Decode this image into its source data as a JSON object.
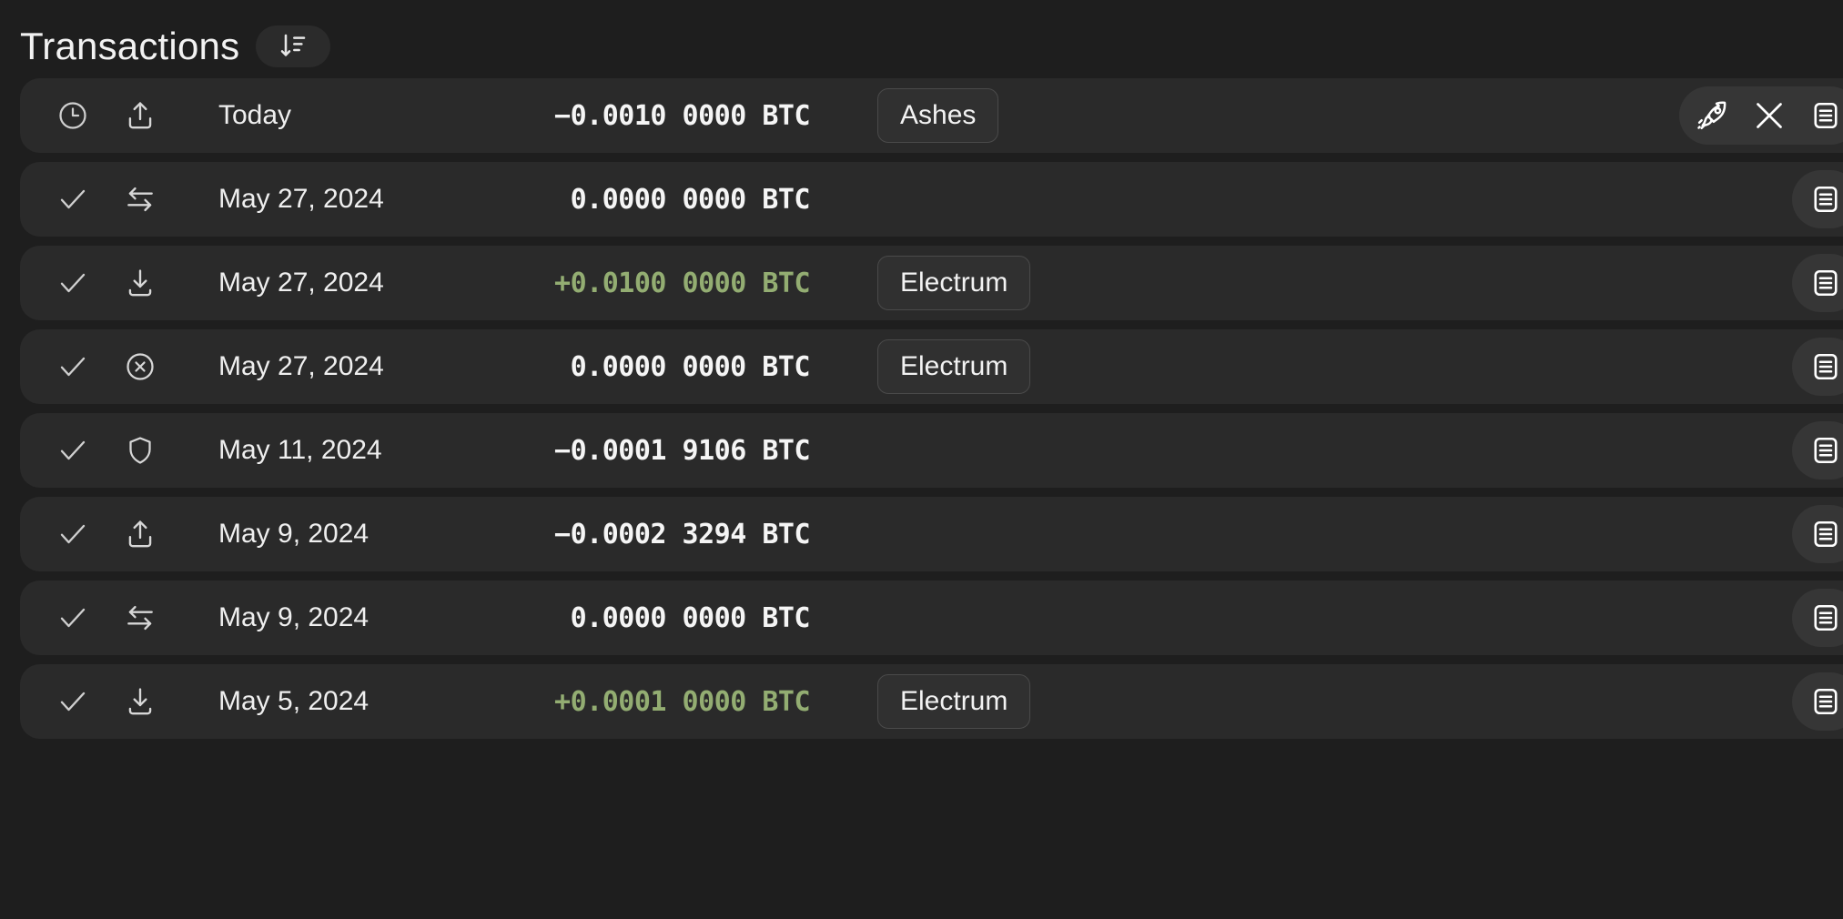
{
  "header": {
    "title": "Transactions",
    "sort_button": {
      "name": "sort-descending",
      "tooltip": "Sort"
    }
  },
  "transactions": [
    {
      "status": "pending",
      "status_icon": "clock-icon",
      "type": "send",
      "type_icon": "upload-icon",
      "date": "Today",
      "amount": "−0.0010 0000 BTC",
      "direction": "negative",
      "label": "Ashes",
      "actions": [
        "rocket-icon",
        "close-icon",
        "details-icon"
      ]
    },
    {
      "status": "confirmed",
      "status_icon": "check-icon",
      "type": "self-transfer",
      "type_icon": "swap-icon",
      "date": "May 27, 2024",
      "amount": "0.0000 0000 BTC",
      "direction": "neutral",
      "label": "",
      "actions": [
        "details-icon"
      ]
    },
    {
      "status": "confirmed",
      "status_icon": "check-icon",
      "type": "receive",
      "type_icon": "download-icon",
      "date": "May 27, 2024",
      "amount": "+0.0100 0000 BTC",
      "direction": "positive",
      "label": "Electrum",
      "actions": [
        "details-icon"
      ]
    },
    {
      "status": "confirmed",
      "status_icon": "check-icon",
      "type": "cancelled",
      "type_icon": "x-circle-icon",
      "date": "May 27, 2024",
      "amount": "0.0000 0000 BTC",
      "direction": "neutral",
      "label": "Electrum",
      "actions": [
        "details-icon"
      ]
    },
    {
      "status": "confirmed",
      "status_icon": "check-icon",
      "type": "consolidation",
      "type_icon": "shield-icon",
      "date": "May 11, 2024",
      "amount": "−0.0001 9106 BTC",
      "direction": "negative",
      "label": "",
      "actions": [
        "details-icon"
      ]
    },
    {
      "status": "confirmed",
      "status_icon": "check-icon",
      "type": "send",
      "type_icon": "upload-icon",
      "date": "May 9, 2024",
      "amount": "−0.0002 3294 BTC",
      "direction": "negative",
      "label": "",
      "actions": [
        "details-icon"
      ]
    },
    {
      "status": "confirmed",
      "status_icon": "check-icon",
      "type": "self-transfer",
      "type_icon": "swap-icon",
      "date": "May 9, 2024",
      "amount": "0.0000 0000 BTC",
      "direction": "neutral",
      "label": "",
      "actions": [
        "details-icon"
      ]
    },
    {
      "status": "confirmed",
      "status_icon": "check-icon",
      "type": "receive",
      "type_icon": "download-icon",
      "date": "May 5, 2024",
      "amount": "+0.0001 0000 BTC",
      "direction": "positive",
      "label": "Electrum",
      "actions": [
        "details-icon"
      ]
    }
  ],
  "colors": {
    "page_background": "#1e1e1e",
    "row_background": "#2a2a2a",
    "positive_amount": "#93ad72",
    "neutral_amount": "#f5f5f5",
    "action_pill": "#363636",
    "label_border": "#4a4a4a"
  }
}
